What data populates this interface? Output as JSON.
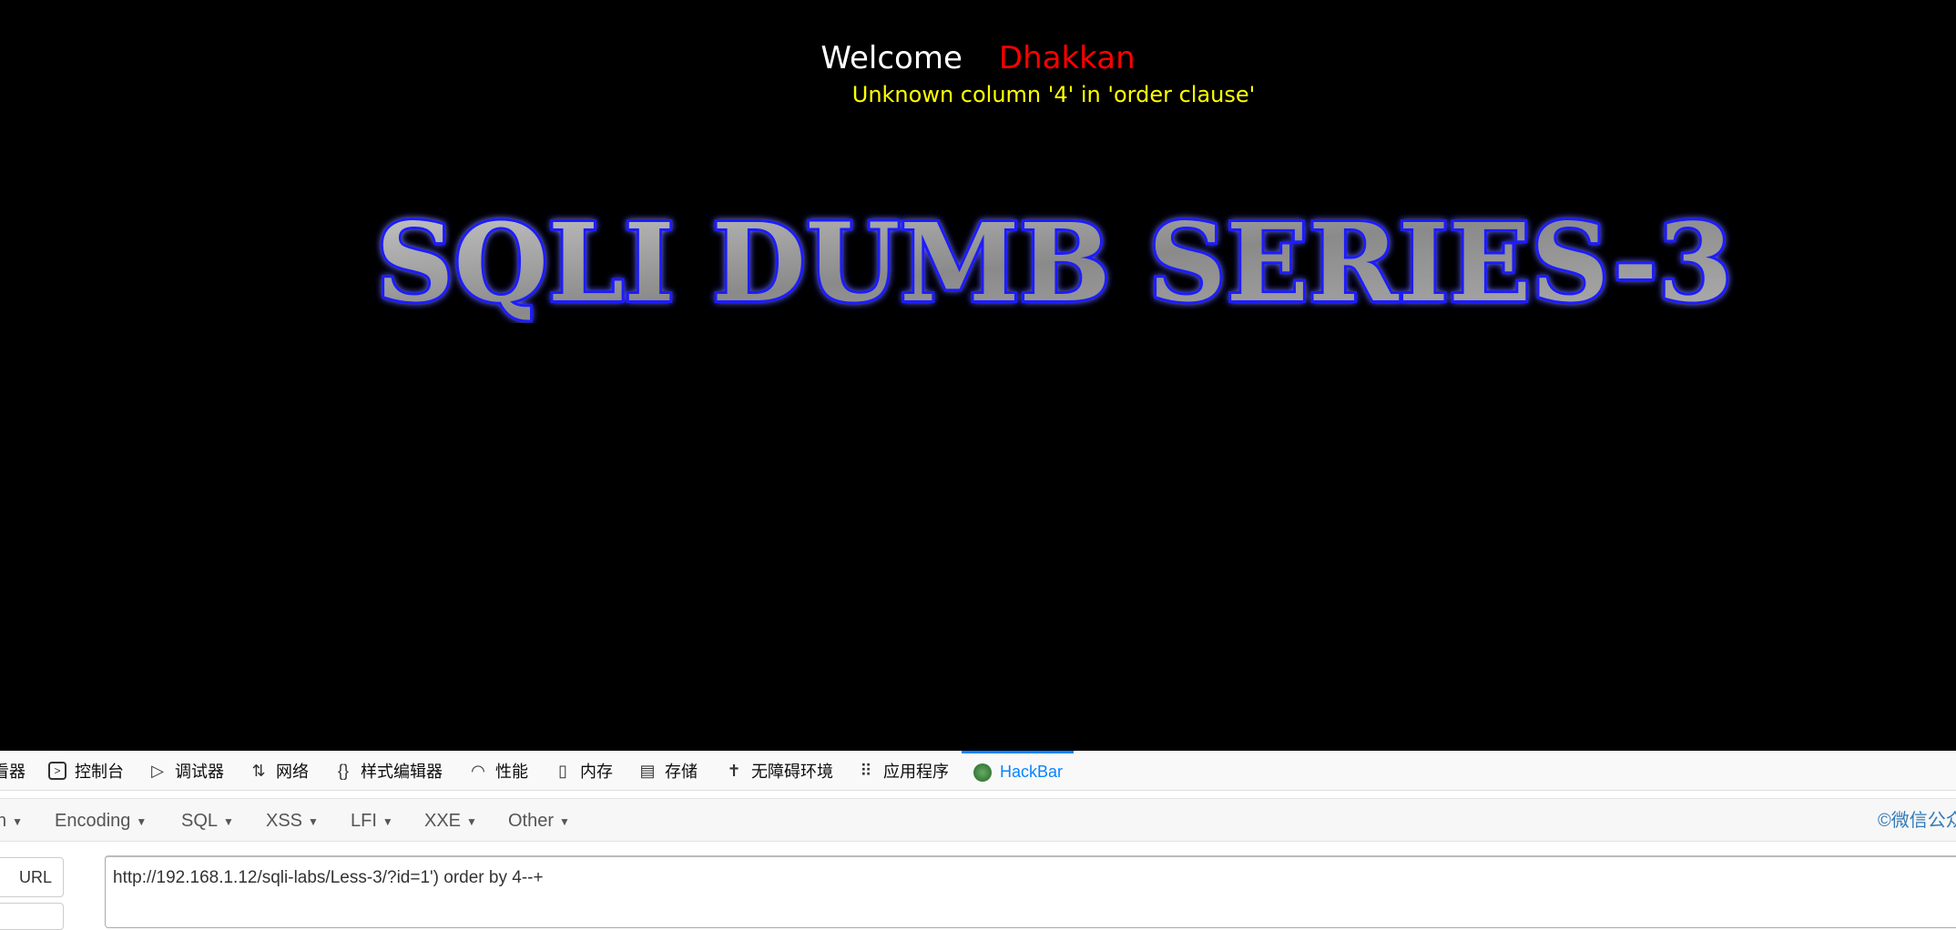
{
  "page": {
    "welcome": "Welcome",
    "name": "Dhakkan",
    "error": "Unknown column '4' in 'order clause'",
    "logo_text": "SQLI DUMB SERIES-3"
  },
  "devtools": {
    "tabs": [
      {
        "label": "看器",
        "icon": "inspector-icon"
      },
      {
        "label": "控制台",
        "icon": "console-icon"
      },
      {
        "label": "调试器",
        "icon": "debugger-icon"
      },
      {
        "label": "网络",
        "icon": "network-icon"
      },
      {
        "label": "样式编辑器",
        "icon": "style-editor-icon"
      },
      {
        "label": "性能",
        "icon": "performance-icon"
      },
      {
        "label": "内存",
        "icon": "memory-icon"
      },
      {
        "label": "存储",
        "icon": "storage-icon"
      },
      {
        "label": "无障碍环境",
        "icon": "accessibility-icon"
      },
      {
        "label": "应用程序",
        "icon": "application-icon"
      },
      {
        "label": "HackBar",
        "icon": "hackbar-icon",
        "active": true
      }
    ]
  },
  "hackbar": {
    "menus": [
      "n",
      "Encoding",
      "SQL",
      "XSS",
      "LFI",
      "XXE",
      "Other"
    ],
    "credit": "©微信公众",
    "url_button": "URL",
    "url_value": "http://192.168.1.12/sqli-labs/Less-3/?id=1') order by 4--+",
    "accent": "#0a84ff"
  }
}
